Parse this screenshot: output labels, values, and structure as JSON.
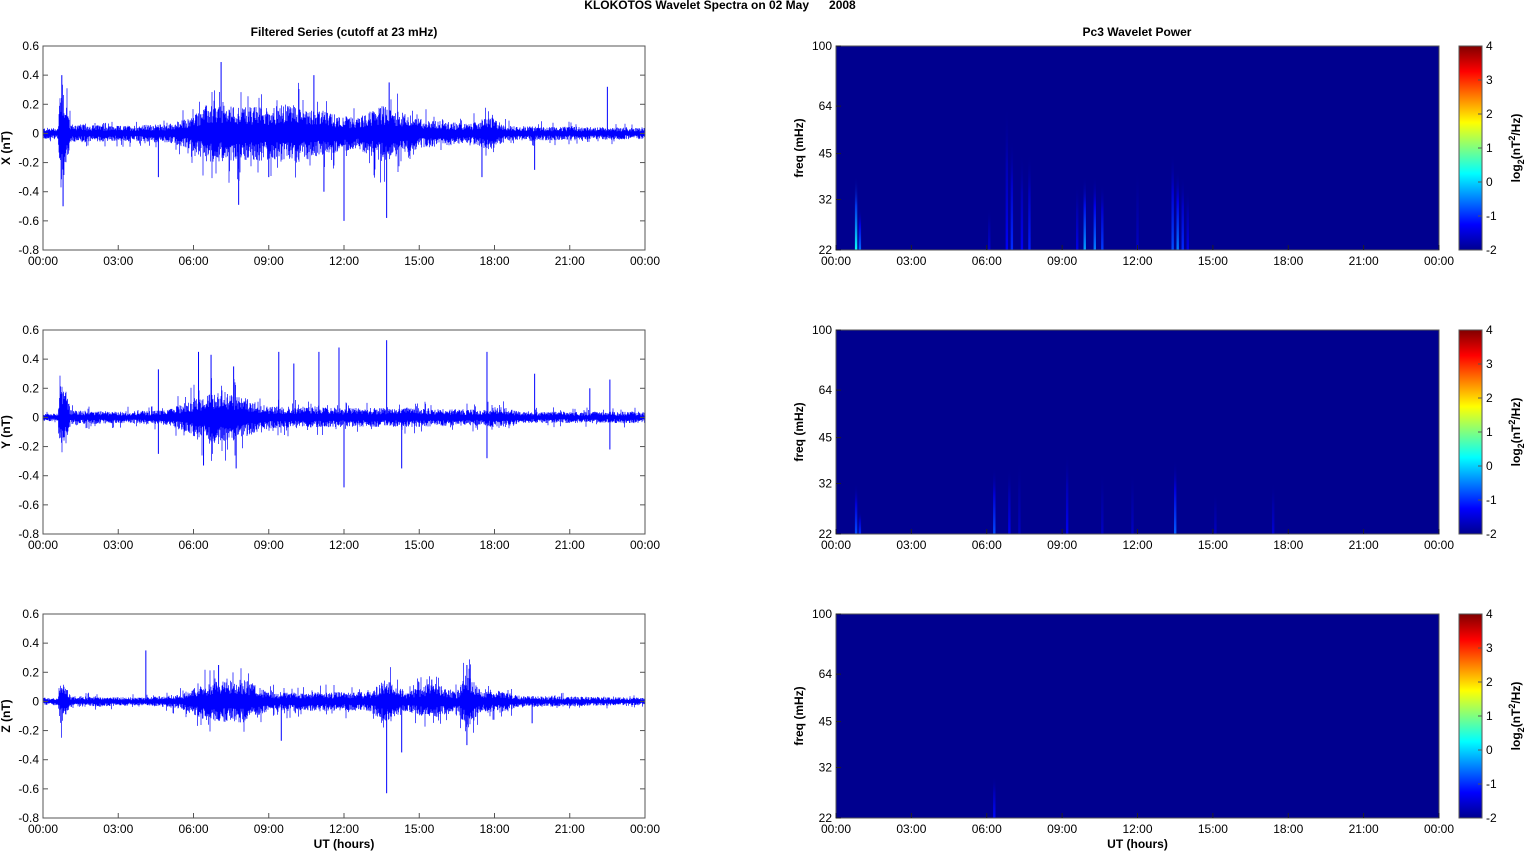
{
  "chart_data": [
    {
      "type": "line",
      "title": "KLOKOTOS Wavelet Spectra on 02 May      2008",
      "panel_group_titles": {
        "left": "Filtered Series (cutoff at 23 mHz)",
        "right": "Pc3 Wavelet Power"
      },
      "xlabel": "UT (hours)",
      "xlim": [
        0,
        24
      ],
      "xticks": [
        0,
        3,
        6,
        9,
        12,
        15,
        18,
        21,
        24
      ],
      "xtick_labels": [
        "00:00",
        "03:00",
        "06:00",
        "09:00",
        "12:00",
        "15:00",
        "18:00",
        "21:00",
        "00:00"
      ],
      "ylim": [
        -0.8,
        0.6
      ],
      "yticks": [
        0.6,
        0.4,
        0.2,
        0,
        -0.2,
        -0.4,
        -0.6,
        -0.8
      ],
      "ytick_labels": [
        "0.6",
        "0.4",
        "0.2",
        "0",
        "-0.2",
        "-0.4",
        "-0.6",
        "-0.8"
      ],
      "line_color": "#0000ff",
      "series": [
        {
          "name": "X",
          "ylabel": "X (nT)",
          "envelope": [
            [
              0,
              0.03
            ],
            [
              0.6,
              0.03
            ],
            [
              0.7,
              0.3
            ],
            [
              0.9,
              0.2
            ],
            [
              1.1,
              0.05
            ],
            [
              3,
              0.04
            ],
            [
              5,
              0.05
            ],
            [
              5.8,
              0.08
            ],
            [
              6.5,
              0.15
            ],
            [
              9,
              0.14
            ],
            [
              10,
              0.16
            ],
            [
              11,
              0.12
            ],
            [
              12.5,
              0.08
            ],
            [
              13.5,
              0.15
            ],
            [
              15,
              0.08
            ],
            [
              17,
              0.05
            ],
            [
              17.8,
              0.09
            ],
            [
              18.5,
              0.04
            ],
            [
              24,
              0.03
            ]
          ],
          "spikes": [
            [
              0.75,
              0.4
            ],
            [
              0.8,
              -0.5
            ],
            [
              4.6,
              -0.3
            ],
            [
              7.1,
              0.49
            ],
            [
              7.8,
              -0.49
            ],
            [
              9.0,
              -0.3
            ],
            [
              10.8,
              0.4
            ],
            [
              11.2,
              -0.4
            ],
            [
              12.0,
              -0.6
            ],
            [
              13.7,
              -0.58
            ],
            [
              13.8,
              0.35
            ],
            [
              17.5,
              -0.3
            ],
            [
              19.6,
              -0.25
            ],
            [
              22.5,
              0.32
            ]
          ]
        },
        {
          "name": "Y",
          "ylabel": "Y (nT)",
          "envelope": [
            [
              0,
              0.02
            ],
            [
              0.6,
              0.02
            ],
            [
              0.7,
              0.2
            ],
            [
              0.9,
              0.15
            ],
            [
              1.1,
              0.04
            ],
            [
              3,
              0.03
            ],
            [
              5,
              0.04
            ],
            [
              6,
              0.1
            ],
            [
              7,
              0.15
            ],
            [
              9,
              0.06
            ],
            [
              12,
              0.05
            ],
            [
              14,
              0.05
            ],
            [
              15,
              0.05
            ],
            [
              17.5,
              0.04
            ],
            [
              18.2,
              0.06
            ],
            [
              19,
              0.03
            ],
            [
              24,
              0.03
            ]
          ],
          "spikes": [
            [
              4.6,
              0.33
            ],
            [
              4.6,
              -0.25
            ],
            [
              6.2,
              0.45
            ],
            [
              6.4,
              -0.33
            ],
            [
              6.7,
              0.43
            ],
            [
              7.6,
              0.35
            ],
            [
              7.7,
              -0.35
            ],
            [
              9.4,
              0.45
            ],
            [
              10.0,
              0.37
            ],
            [
              11.0,
              0.45
            ],
            [
              11.8,
              0.48
            ],
            [
              12.0,
              -0.48
            ],
            [
              13.7,
              0.53
            ],
            [
              14.3,
              -0.35
            ],
            [
              17.7,
              0.45
            ],
            [
              17.7,
              -0.28
            ],
            [
              19.6,
              0.3
            ],
            [
              21.8,
              0.2
            ],
            [
              22.6,
              0.26
            ],
            [
              22.6,
              -0.22
            ]
          ]
        },
        {
          "name": "Z",
          "ylabel": "Z (nT)",
          "envelope": [
            [
              0,
              0.02
            ],
            [
              0.6,
              0.02
            ],
            [
              0.7,
              0.12
            ],
            [
              0.9,
              0.08
            ],
            [
              1.1,
              0.03
            ],
            [
              4,
              0.02
            ],
            [
              5.5,
              0.04
            ],
            [
              6.5,
              0.1
            ],
            [
              8,
              0.12
            ],
            [
              9,
              0.05
            ],
            [
              11,
              0.05
            ],
            [
              13,
              0.05
            ],
            [
              13.7,
              0.12
            ],
            [
              14.5,
              0.05
            ],
            [
              15.5,
              0.1
            ],
            [
              16.5,
              0.05
            ],
            [
              16.9,
              0.15
            ],
            [
              17.5,
              0.05
            ],
            [
              18.2,
              0.06
            ],
            [
              19,
              0.03
            ],
            [
              24,
              0.02
            ]
          ],
          "spikes": [
            [
              4.1,
              0.35
            ],
            [
              7.0,
              0.25
            ],
            [
              9.5,
              -0.27
            ],
            [
              13.7,
              -0.63
            ],
            [
              14.3,
              -0.35
            ],
            [
              15.5,
              0.15
            ],
            [
              16.9,
              0.25
            ],
            [
              16.9,
              -0.3
            ],
            [
              19.5,
              -0.15
            ]
          ]
        }
      ]
    },
    {
      "type": "heatmap",
      "title": "Pc3 Wavelet Power",
      "xlabel": "UT (hours)",
      "ylabel": "freq (mHz)",
      "xlim": [
        0,
        24
      ],
      "ylim": [
        22,
        100
      ],
      "yscale": "log",
      "yticks": [
        100,
        64,
        45,
        32,
        22
      ],
      "ytick_labels": [
        "100",
        "64",
        "45",
        "32",
        "22"
      ],
      "xticks": [
        0,
        3,
        6,
        9,
        12,
        15,
        18,
        21,
        24
      ],
      "xtick_labels": [
        "00:00",
        "03:00",
        "06:00",
        "09:00",
        "12:00",
        "15:00",
        "18:00",
        "21:00",
        "00:00"
      ],
      "colorbar": {
        "label": "log2(nT2/Hz)",
        "label_base": "log",
        "label_sub": "2",
        "label_mid": "(nT",
        "label_sup": "2",
        "label_end": "/Hz)",
        "range": [
          -2,
          4
        ],
        "ticks": [
          "4",
          "3",
          "2",
          "1",
          "0",
          "-1",
          "-2"
        ],
        "colormap": "jet"
      },
      "background_value": -2,
      "background_color": "#00008f",
      "panels": [
        {
          "name": "X",
          "bursts": [
            [
              0.8,
              38,
              0.3
            ],
            [
              0.95,
              30,
              -0.6
            ],
            [
              6.1,
              30,
              -1.5
            ],
            [
              6.8,
              64,
              -1.3
            ],
            [
              7.0,
              50,
              -1.0
            ],
            [
              7.4,
              45,
              -1.3
            ],
            [
              7.7,
              45,
              -1.1
            ],
            [
              9.6,
              36,
              -1.4
            ],
            [
              9.9,
              38,
              -0.3
            ],
            [
              10.3,
              38,
              -0.5
            ],
            [
              10.6,
              36,
              -0.9
            ],
            [
              12.0,
              40,
              -1.6
            ],
            [
              13.4,
              45,
              -0.8
            ],
            [
              13.6,
              40,
              -0.5
            ],
            [
              13.8,
              38,
              -1.0
            ],
            [
              14.0,
              35,
              -1.4
            ]
          ]
        },
        {
          "name": "Y",
          "bursts": [
            [
              0.8,
              32,
              -0.8
            ],
            [
              0.95,
              26,
              -1.0
            ],
            [
              6.3,
              36,
              -0.8
            ],
            [
              6.9,
              36,
              -1.3
            ],
            [
              7.3,
              38,
              -1.6
            ],
            [
              9.2,
              40,
              -1.3
            ],
            [
              10.6,
              35,
              -1.6
            ],
            [
              11.8,
              35,
              -1.6
            ],
            [
              13.5,
              38,
              -0.7
            ],
            [
              15.1,
              30,
              -1.6
            ],
            [
              17.4,
              32,
              -1.5
            ]
          ]
        },
        {
          "name": "Z",
          "bursts": [
            [
              6.3,
              30,
              -1.2
            ]
          ]
        }
      ]
    }
  ]
}
